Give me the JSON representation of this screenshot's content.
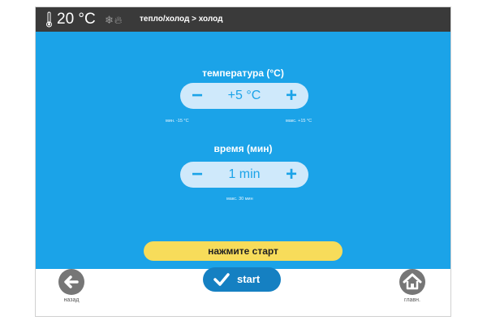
{
  "header": {
    "current_temperature": "20 °C",
    "breadcrumb": "тепло/холод > холод",
    "icons": [
      "thermometer-icon",
      "snowflake-icon",
      "flame-icon"
    ]
  },
  "temperature": {
    "label": "температура (°C)",
    "value": "+5 °C",
    "min_hint": "мин. -15 °C",
    "max_hint": "макс. +15 °C"
  },
  "time": {
    "label": "время (мин)",
    "value": "1 min",
    "max_hint": "макс. 30 мин"
  },
  "prompt": "нажмите старт",
  "actions": {
    "start_label": "start",
    "back_label": "назад",
    "home_label": "главн."
  },
  "colors": {
    "panel": "#1ba3e8",
    "stepper_bg": "#cfe9fb",
    "prompt_bg": "#f7dc5a",
    "start_button": "#1580c2",
    "nav_button": "#767676",
    "topbar": "#3a3a3a"
  }
}
